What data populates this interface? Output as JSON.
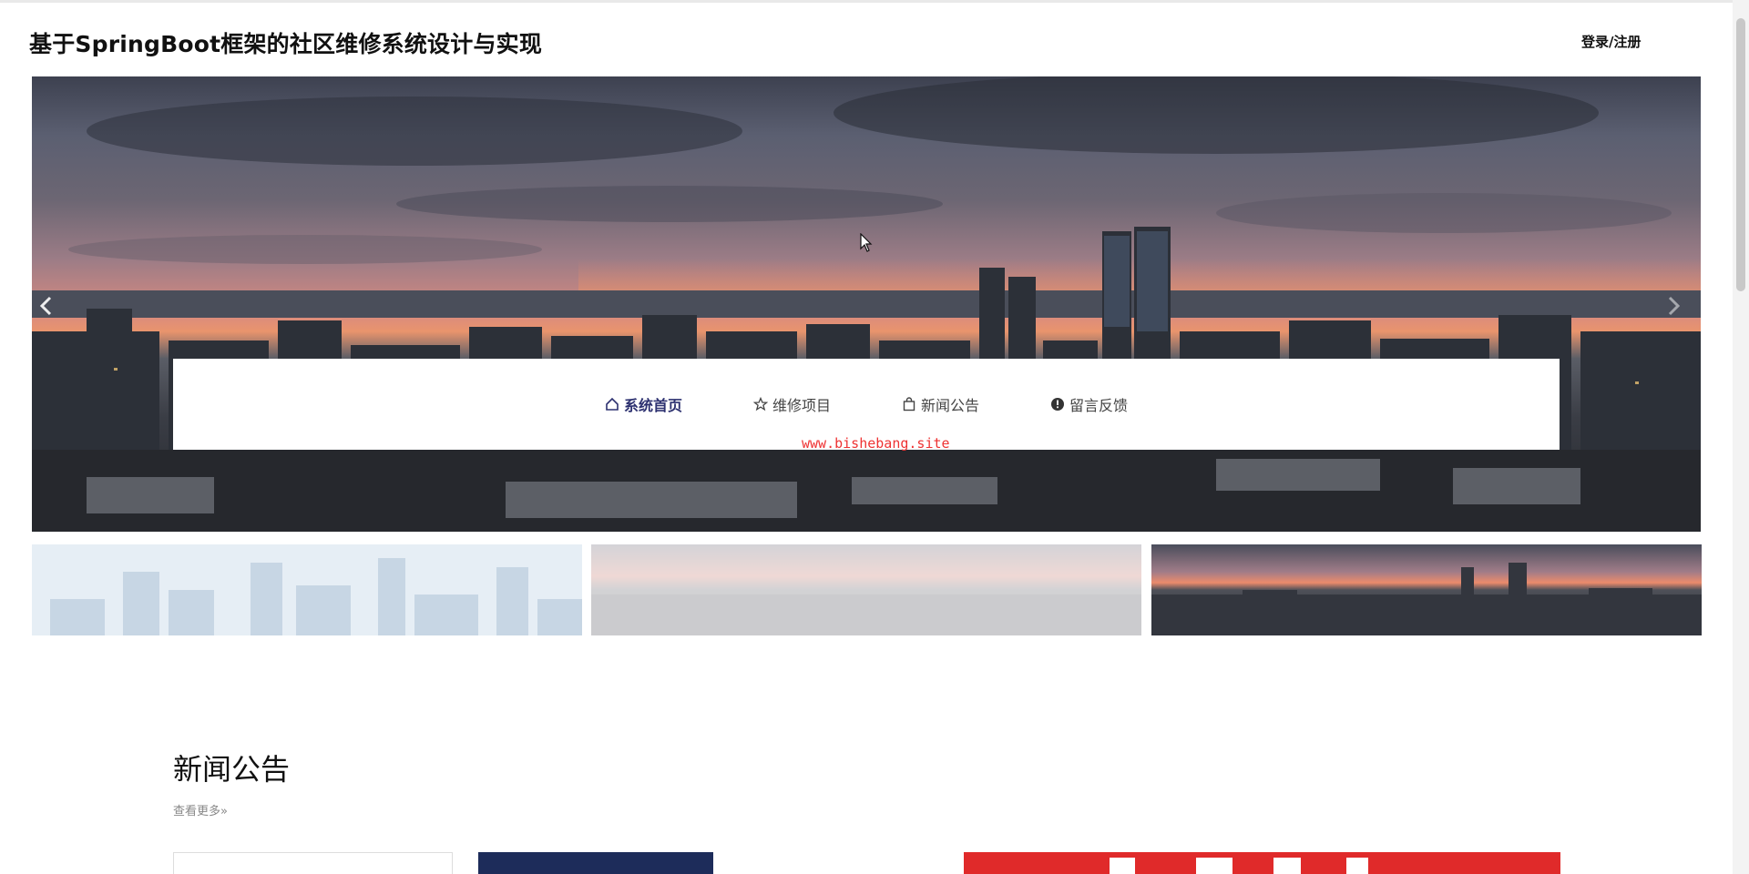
{
  "header": {
    "site_title": "基于SpringBoot框架的社区维修系统设计与实现",
    "login_label": "登录/注册"
  },
  "hero": {
    "prev_icon": "chevron-left-icon",
    "next_icon": "chevron-right-icon"
  },
  "nav": {
    "items": [
      {
        "label": "系统首页",
        "icon": "home-icon",
        "active": true
      },
      {
        "label": "维修项目",
        "icon": "star-icon",
        "active": false
      },
      {
        "label": "新闻公告",
        "icon": "bag-icon",
        "active": false
      },
      {
        "label": "留言反馈",
        "icon": "alert-icon",
        "active": false
      }
    ]
  },
  "watermark": "www.bishebang.site",
  "news": {
    "title": "新闻公告",
    "more_label": "查看更多»"
  },
  "colors": {
    "nav_active": "#2d3170",
    "watermark": "#e33333"
  }
}
